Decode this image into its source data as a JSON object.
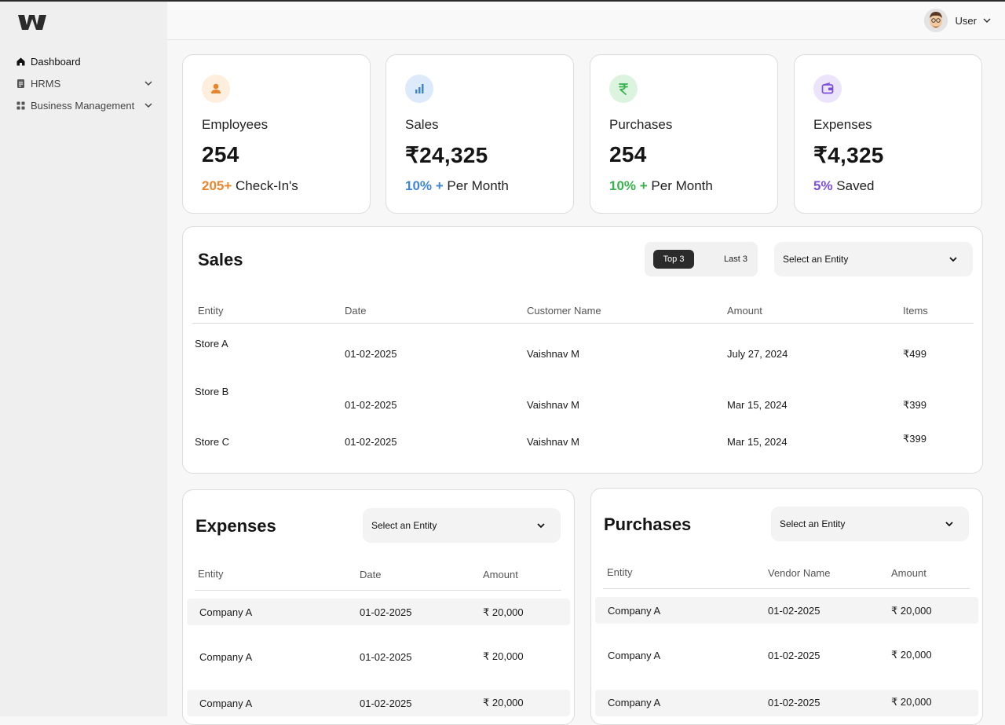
{
  "sidebar": {
    "items": [
      {
        "label": "Dashboard"
      },
      {
        "label": "HRMS"
      },
      {
        "label": "Business Management"
      }
    ]
  },
  "header": {
    "user_name": "User"
  },
  "stats": [
    {
      "title": "Employees",
      "value": "254",
      "highlight": "205+",
      "suffix": " Check-In's",
      "color": "#e8852b",
      "icon_bg": "#fdeedd",
      "icon": "person-icon"
    },
    {
      "title": "Sales",
      "value": "₹24,325",
      "highlight": "10% +",
      "suffix": " Per Month",
      "color": "#3f86d6",
      "icon_bg": "#ddeafb",
      "icon": "bar-chart-icon"
    },
    {
      "title": "Purchases",
      "value": "254",
      "highlight": "10% +",
      "suffix": " Per Month",
      "color": "#37b24d",
      "icon_bg": "#dcf3e0",
      "icon": "rupee-icon"
    },
    {
      "title": "Expenses",
      "value": "₹4,325",
      "highlight": "5%",
      "suffix": " Saved",
      "color": "#7b4fd8",
      "icon_bg": "#ece4fb",
      "icon": "wallet-icon"
    }
  ],
  "sales": {
    "title": "Sales",
    "toggle": {
      "selected": "Top 3",
      "other": "Last 3"
    },
    "select_placeholder": "Select an Entity",
    "columns": [
      "Entity",
      "Date",
      "Customer Name",
      "Amount",
      "Items"
    ],
    "rows": [
      {
        "entity": "Store A",
        "date": "01-02-2025",
        "customer": "Vaishnav M",
        "amount": "July 27, 2024",
        "items": "₹499"
      },
      {
        "entity": "Store B",
        "date": "01-02-2025",
        "customer": "Vaishnav M",
        "amount": "Mar 15, 2024",
        "items": "₹399"
      },
      {
        "entity": "Store C",
        "date": "01-02-2025",
        "customer": "Vaishnav M",
        "amount": "Mar 15, 2024",
        "items": "₹399"
      }
    ]
  },
  "expenses": {
    "title": "Expenses",
    "select_placeholder": "Select an Entity",
    "columns": [
      "Entity",
      "Date",
      "Amount"
    ],
    "rows": [
      {
        "entity": "Company A",
        "date": "01-02-2025",
        "amount": "₹ 20,000"
      },
      {
        "entity": "Company A",
        "date": "01-02-2025",
        "amount": "₹ 20,000"
      },
      {
        "entity": "Company A",
        "date": "01-02-2025",
        "amount": "₹ 20,000"
      }
    ]
  },
  "purchases": {
    "title": "Purchases",
    "select_placeholder": "Select an Entity",
    "columns": [
      "Entity",
      "Vendor Name",
      "Amount"
    ],
    "rows": [
      {
        "entity": "Company A",
        "vendor": "01-02-2025",
        "amount": "₹ 20,000"
      },
      {
        "entity": "Company A",
        "vendor": "01-02-2025",
        "amount": "₹ 20,000"
      },
      {
        "entity": "Company A",
        "vendor": "01-02-2025",
        "amount": "₹ 20,000"
      }
    ]
  }
}
